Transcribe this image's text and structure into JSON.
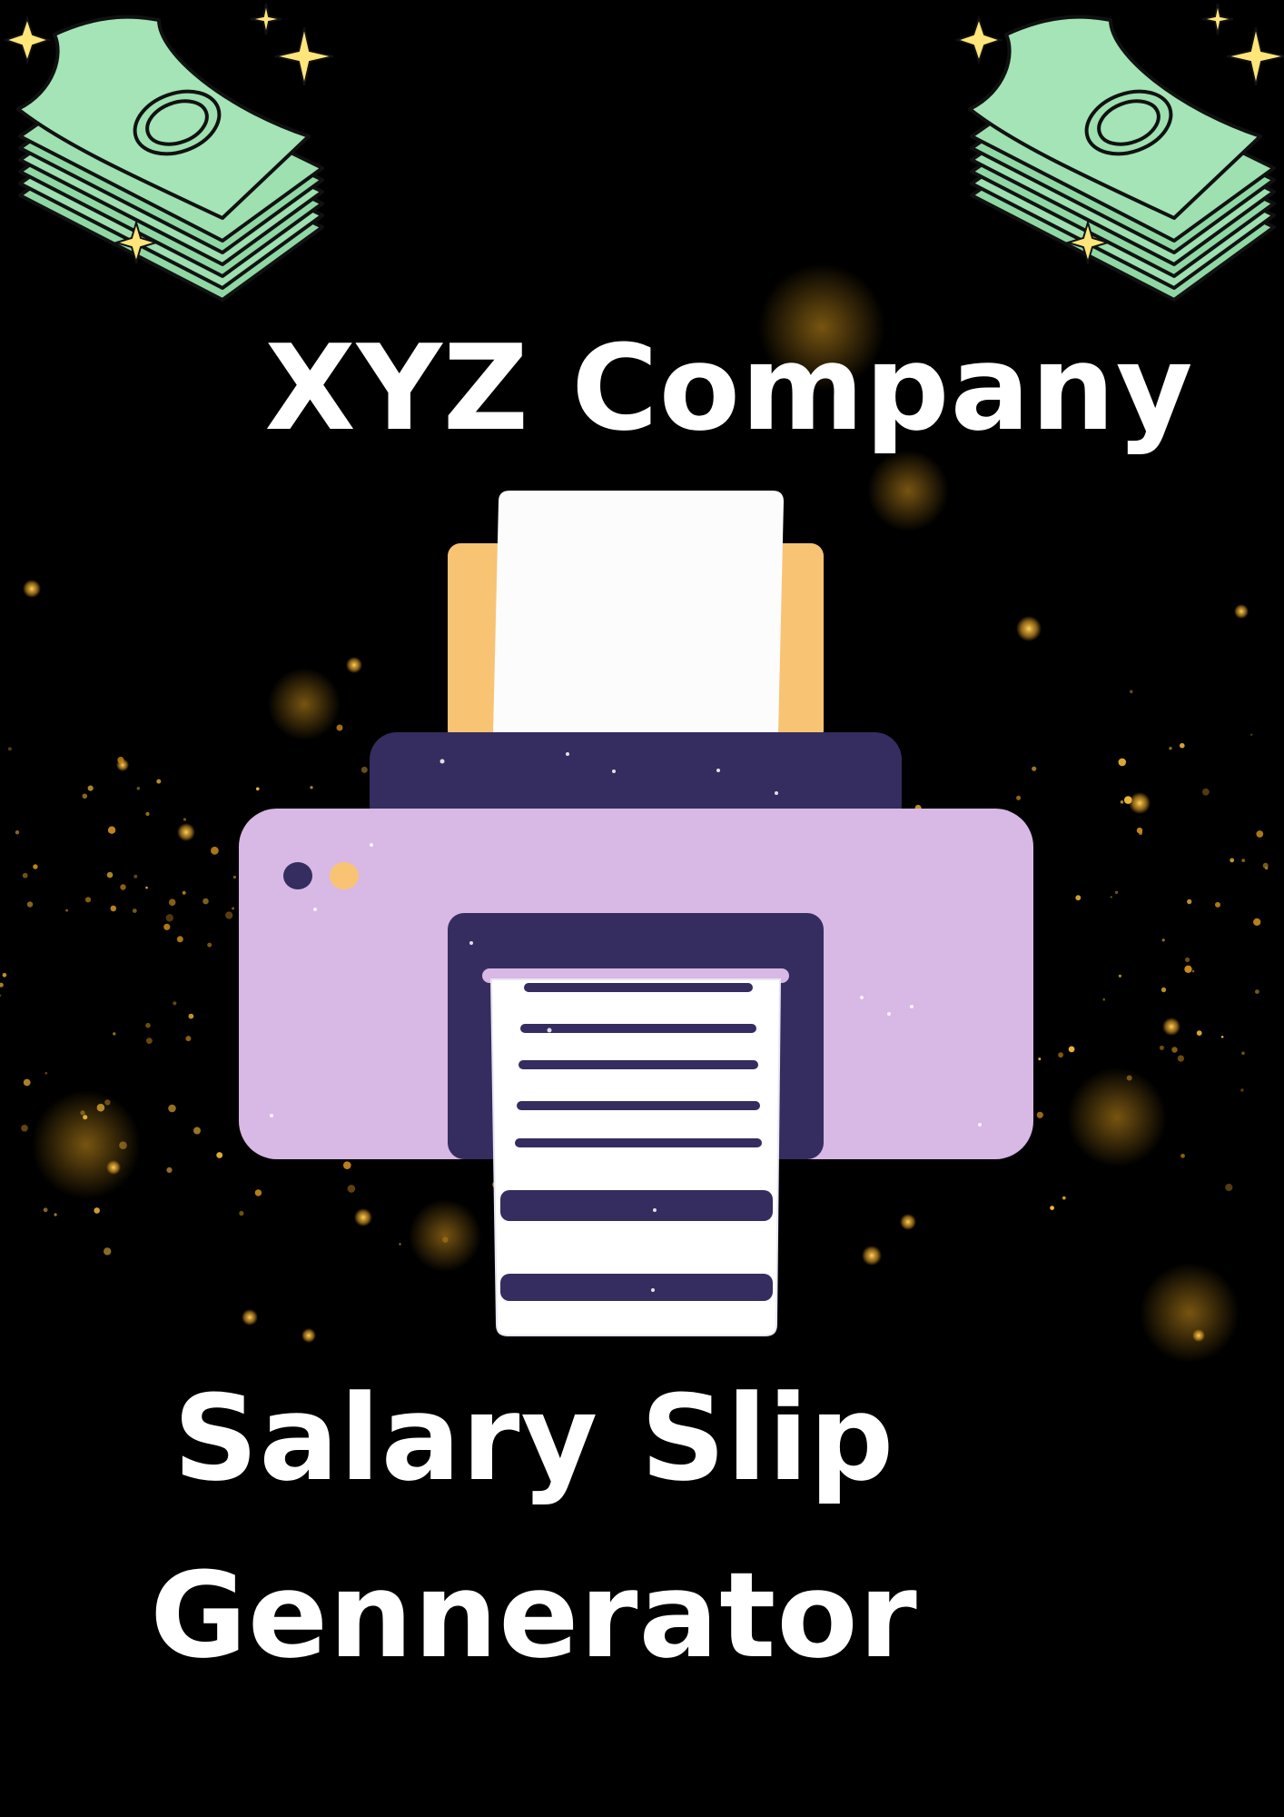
{
  "header": {
    "company_name": "XYZ Company"
  },
  "footer": {
    "title_line_1": "Salary Slip",
    "title_line_2": "Gennerator"
  },
  "colors": {
    "background": "#000000",
    "text": "#ffffff",
    "printer_body": "#d8b8e4",
    "printer_dark": "#352d5f",
    "paper_tray": "#f9c374",
    "paper": "#ffffff",
    "money_green": "#9ee0b0",
    "sparkle": "#ffe57a",
    "bokeh": "#e0a020"
  },
  "icons": {
    "printer": "printer-icon",
    "money_left": "money-stack-icon",
    "money_right": "money-stack-icon"
  }
}
